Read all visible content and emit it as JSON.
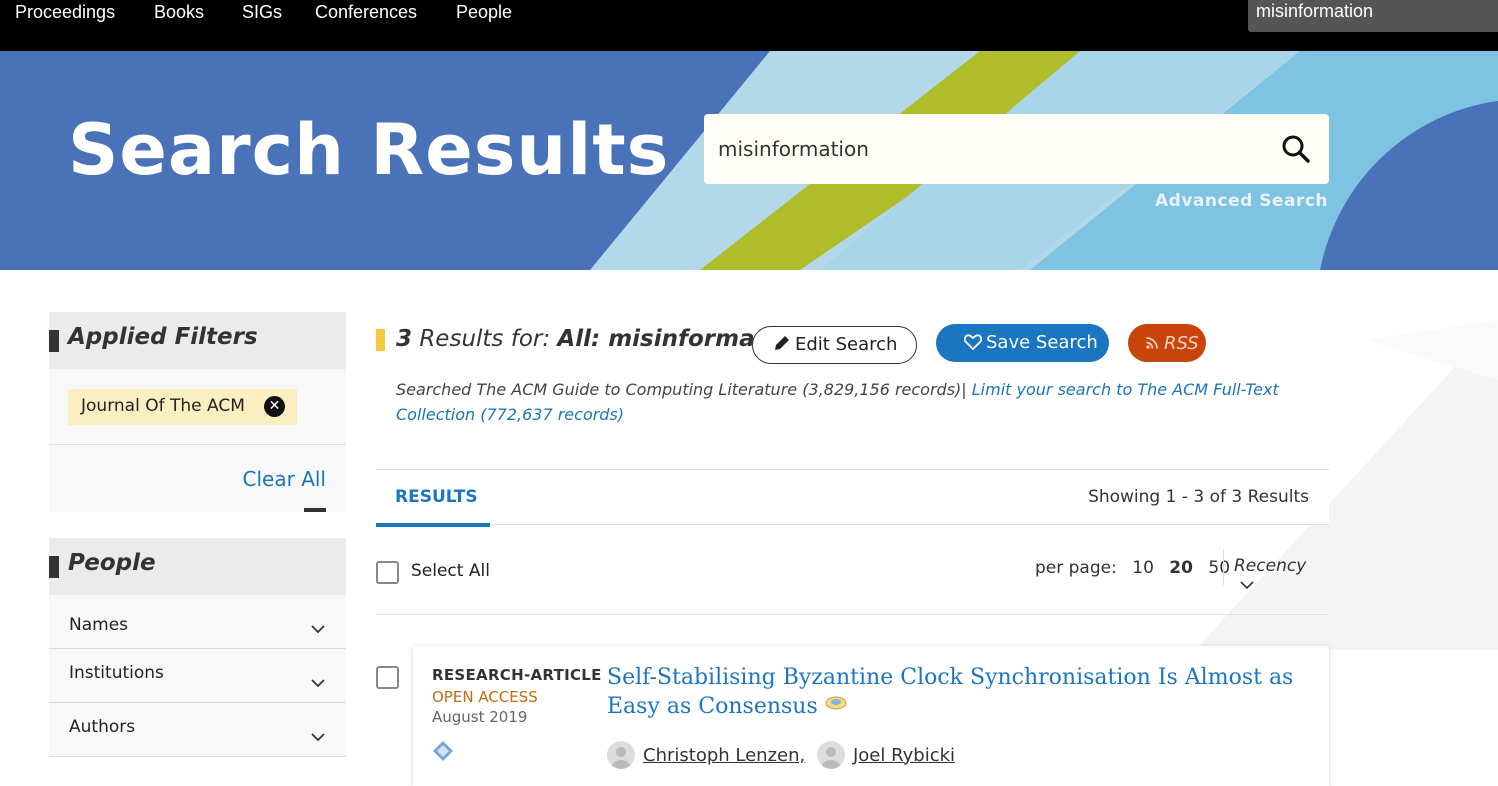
{
  "topnav": {
    "items": [
      "Proceedings",
      "Books",
      "SIGs",
      "Conferences",
      "People"
    ],
    "search_value": "misinformation"
  },
  "banner": {
    "title": "Search Results",
    "search_value": "misinformation",
    "advanced_search": "Advanced Search"
  },
  "sidebar": {
    "applied_filters_title": "Applied Filters",
    "filter_chip": "Journal Of The ACM",
    "clear_all": "Clear All",
    "people_title": "People",
    "people_items": [
      "Names",
      "Institutions",
      "Authors"
    ]
  },
  "results": {
    "count": "3",
    "results_for": "Results for:",
    "query": "All: misinformation",
    "edit_search": "Edit Search",
    "save_search": "Save Search",
    "rss": "RSS",
    "searched_text": "Searched The ACM Guide to Computing Literature (3,829,156 records)|",
    "limit_link": "Limit your search to The ACM Full-Text Collection (772,637 records)",
    "tab_label": "RESULTS",
    "showing": "Showing 1 - 3  of 3 Results",
    "select_all": "Select All",
    "per_page_label": "per page:",
    "per_page_options": [
      "10",
      "20",
      "50"
    ],
    "per_page_selected": "20",
    "sort": "Recency"
  },
  "card": {
    "type": "RESEARCH-ARTICLE",
    "access": "OPEN ACCESS",
    "date": "August 2019",
    "title": "Self-Stabilising Byzantine Clock Synchronisation Is Almost as Easy as Consensus",
    "authors": [
      "Christoph Lenzen,",
      "Joel Rybicki"
    ]
  },
  "colors": {
    "banner": "#4a72b8",
    "accent_blue": "#1b76c2",
    "rss": "#c8440a",
    "chip": "#fbeec1",
    "open_access": "#c46b12"
  }
}
